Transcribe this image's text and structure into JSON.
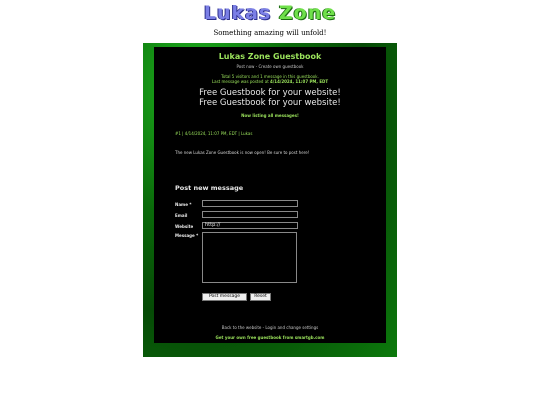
{
  "logo": {
    "word1": "Lukas",
    "word2": "Zone"
  },
  "tagline": "Something amazing will unfold!",
  "guestbook": {
    "title": "Lukas Zone Guestbook",
    "sublinks": {
      "post_now": "Post now",
      "sep": " - ",
      "create": "Create own guestbook"
    },
    "stats_line1": "Total 5 visitors and 1 message in this guestbook.",
    "stats_line2_prefix": "Last message was posted at ",
    "stats_line2_date": "4/14/2024, 11:07 PM, EDT",
    "free_line1": "Free Guestbook for your website!",
    "free_line2": "Free Guestbook for your website!",
    "listing": "Now listing all messages!",
    "post": {
      "meta": "#1 | 4/14/2024, 11:07 PM, EDT | Lukas",
      "body": "The new Lukas Zone Guestbook is now open! Be sure to post here!"
    },
    "form": {
      "heading": "Post new message",
      "name_label": "Name *",
      "email_label": "Email",
      "website_label": "Website",
      "website_value": "http://",
      "message_label": "Message *",
      "post_button": "Post message",
      "reset_button": "Reset"
    },
    "footer": {
      "back": "Back to the website",
      "sep": " - ",
      "login": "Login and change settings",
      "promo": "Get your own free guestbook from smartgb.com"
    }
  }
}
